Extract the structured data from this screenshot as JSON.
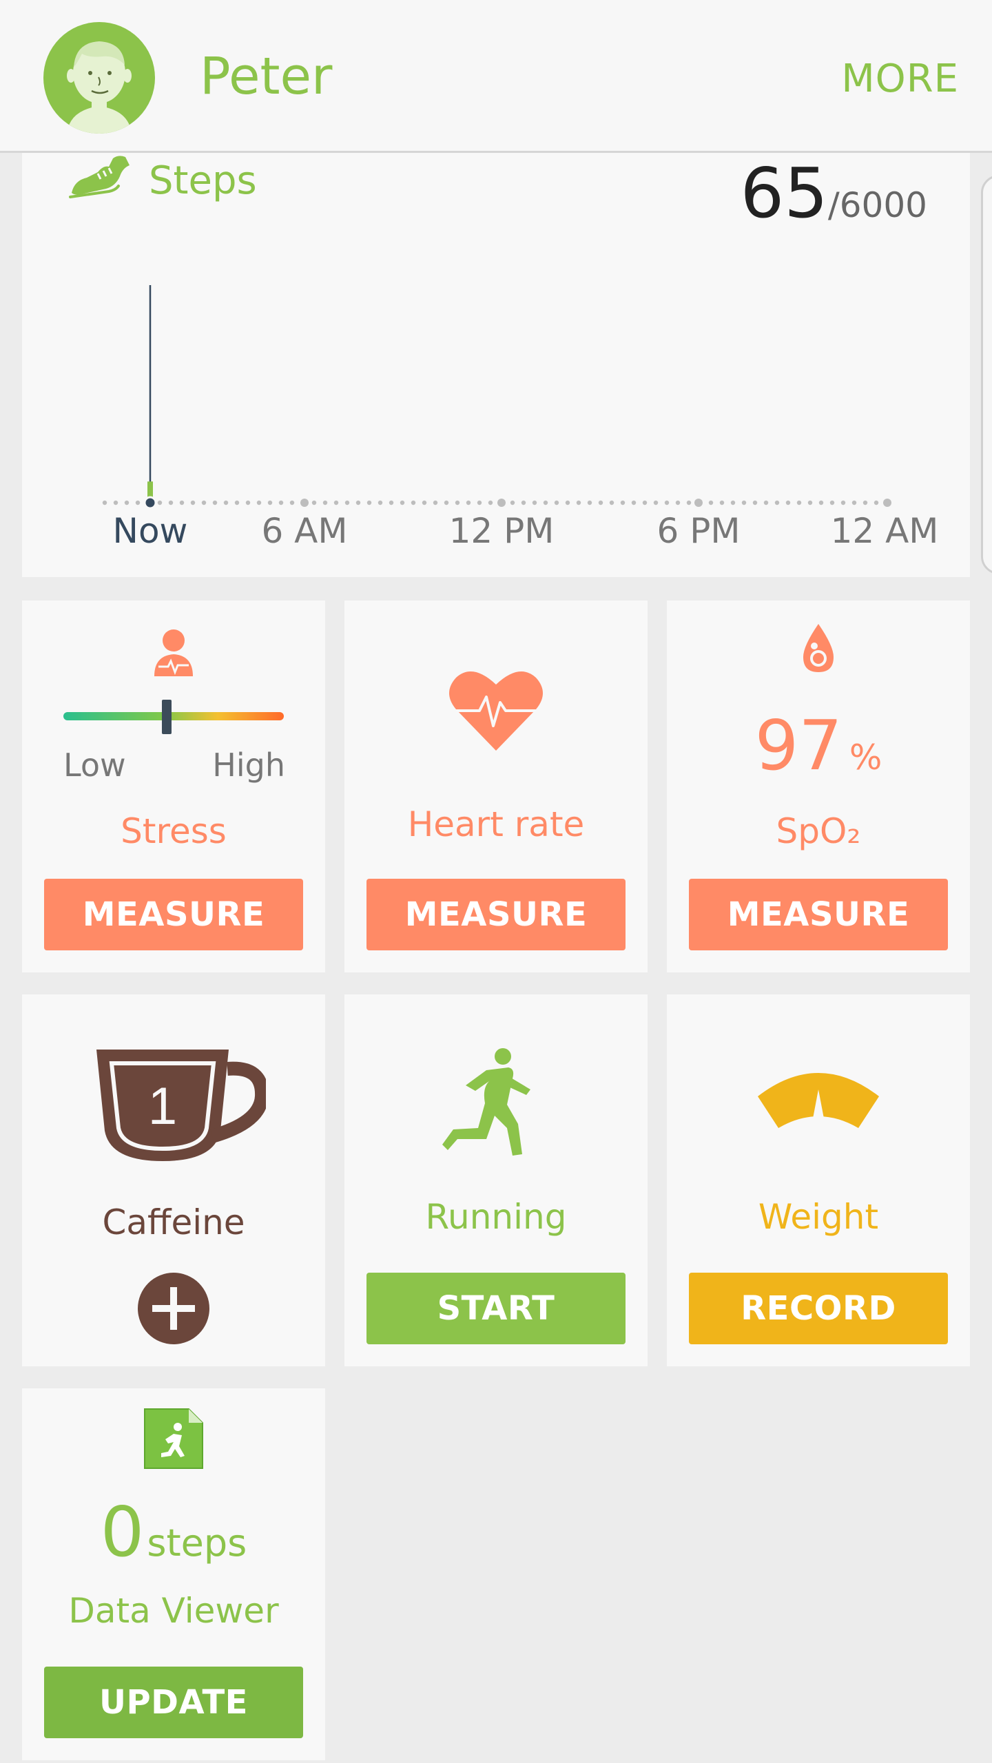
{
  "header": {
    "user_name": "Peter",
    "more_label": "MORE"
  },
  "steps": {
    "title": "Steps",
    "current": "65",
    "goal_separator": "/",
    "goal": "6000",
    "tick_labels": [
      "Now",
      "6 AM",
      "12 PM",
      "6 PM",
      "12 AM"
    ]
  },
  "chart_data": {
    "type": "bar",
    "x": [
      "Now"
    ],
    "values": [
      65
    ],
    "xlabel": "",
    "ylabel": "",
    "tick_labels": [
      "Now",
      "6 AM",
      "12 PM",
      "6 PM",
      "12 AM"
    ],
    "goal": 6000
  },
  "tiles": {
    "stress": {
      "low": "Low",
      "high": "High",
      "label": "Stress",
      "button": "MEASURE",
      "level": 0.47
    },
    "heart_rate": {
      "label": "Heart rate",
      "button": "MEASURE"
    },
    "spo2": {
      "value": "97",
      "unit": "%",
      "label": "SpO₂",
      "button": "MEASURE"
    },
    "caffeine": {
      "count": "1",
      "label": "Caffeine"
    },
    "running": {
      "label": "Running",
      "button": "START"
    },
    "weight": {
      "label": "Weight",
      "button": "RECORD"
    },
    "data_viewer": {
      "value": "0",
      "unit": "steps",
      "label": "Data Viewer",
      "button": "UPDATE"
    }
  },
  "colors": {
    "green": "#8cc34a",
    "orange": "#ff8a66",
    "yellow": "#f0b41a",
    "brown": "#6b463b"
  },
  "icons": [
    "avatar",
    "shoe-icon",
    "stress-person-icon",
    "heart-rate-icon",
    "oxygen-drop-icon",
    "coffee-cup-icon",
    "plus-icon",
    "runner-icon",
    "scale-icon",
    "data-viewer-icon"
  ]
}
